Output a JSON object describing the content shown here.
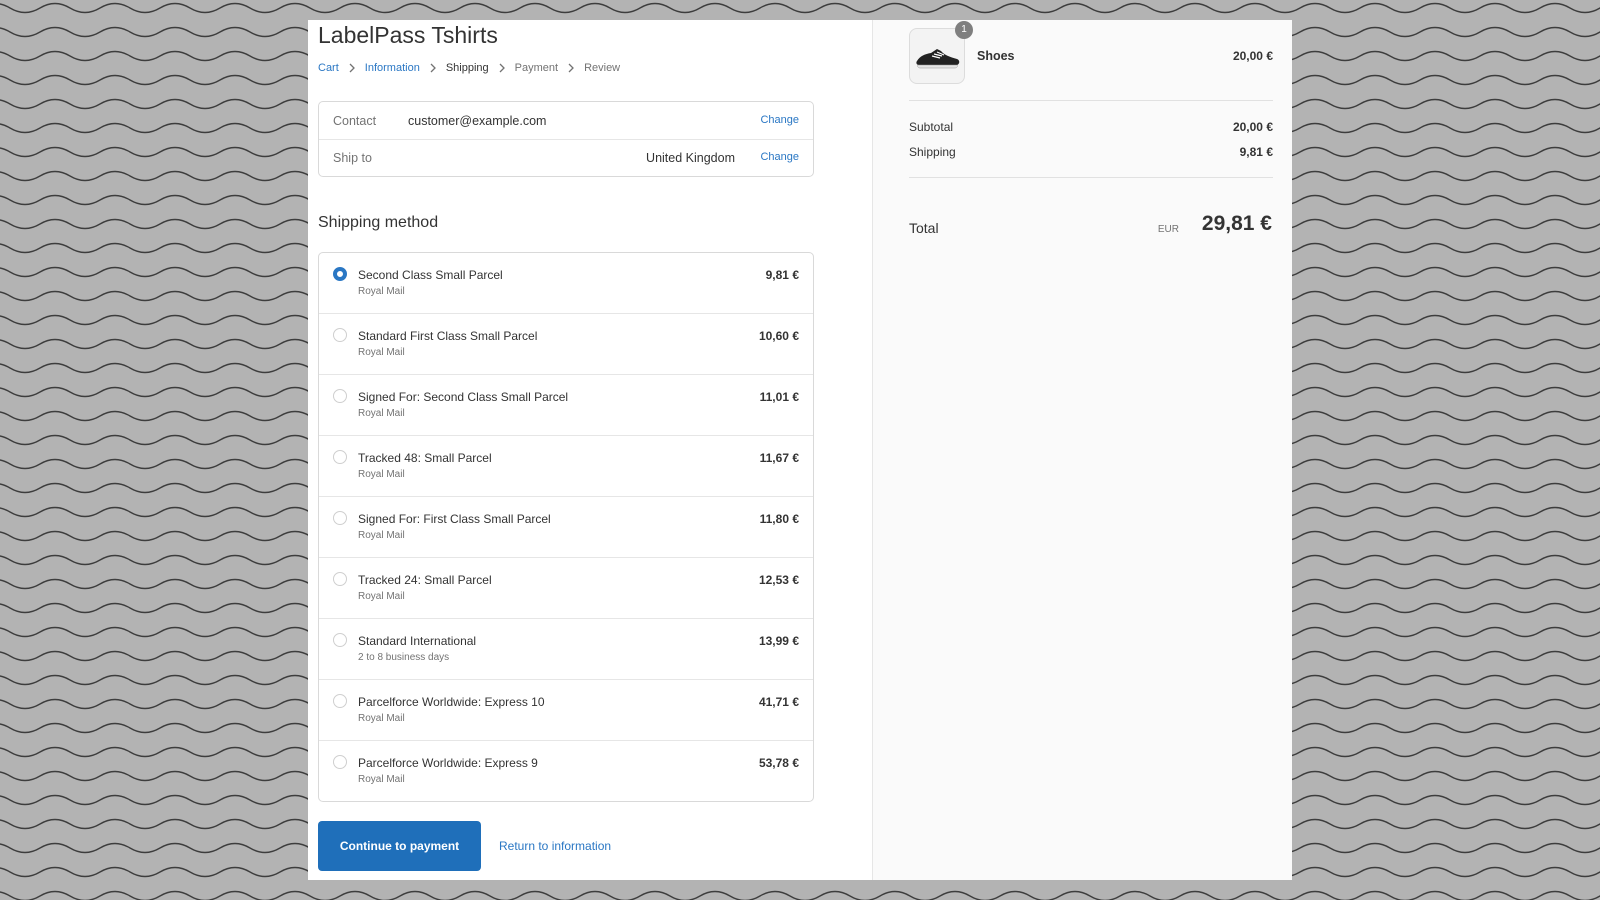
{
  "store": {
    "title": "LabelPass Tshirts"
  },
  "breadcrumb": [
    {
      "label": "Cart",
      "state": "link"
    },
    {
      "label": "Information",
      "state": "link"
    },
    {
      "label": "Shipping",
      "state": "current"
    },
    {
      "label": "Payment",
      "state": "upcoming"
    },
    {
      "label": "Review",
      "state": "upcoming"
    }
  ],
  "review": {
    "contact": {
      "label": "Contact",
      "value": "customer@example.com",
      "action": "Change"
    },
    "ship_to": {
      "label": "Ship to",
      "value": "United Kingdom",
      "action": "Change"
    }
  },
  "shipping": {
    "title": "Shipping method",
    "methods": [
      {
        "name": "Second Class Small Parcel",
        "sub": "Royal Mail",
        "price": "9,81 €",
        "selected": true
      },
      {
        "name": "Standard First Class Small Parcel",
        "sub": "Royal Mail",
        "price": "10,60 €",
        "selected": false
      },
      {
        "name": "Signed For: Second Class Small Parcel",
        "sub": "Royal Mail",
        "price": "11,01 €",
        "selected": false
      },
      {
        "name": "Tracked 48: Small Parcel",
        "sub": "Royal Mail",
        "price": "11,67 €",
        "selected": false
      },
      {
        "name": "Signed For: First Class Small Parcel",
        "sub": "Royal Mail",
        "price": "11,80 €",
        "selected": false
      },
      {
        "name": "Tracked 24: Small Parcel",
        "sub": "Royal Mail",
        "price": "12,53 €",
        "selected": false
      },
      {
        "name": "Standard International",
        "sub": "2 to 8 business days",
        "price": "13,99 €",
        "selected": false
      },
      {
        "name": "Parcelforce Worldwide: Express 10",
        "sub": "Royal Mail",
        "price": "41,71 €",
        "selected": false
      },
      {
        "name": "Parcelforce Worldwide: Express 9",
        "sub": "Royal Mail",
        "price": "53,78 €",
        "selected": false
      }
    ]
  },
  "actions": {
    "continue_label": "Continue to payment",
    "return_label": "Return to information"
  },
  "summary": {
    "product": {
      "name": "Shoes",
      "price": "20,00 €",
      "quantity": "1",
      "icon": "shoe-icon"
    },
    "subtotal_label": "Subtotal",
    "subtotal_value": "20,00 €",
    "shipping_label": "Shipping",
    "shipping_value": "9,81 €",
    "total_label": "Total",
    "currency": "EUR",
    "total_value": "29,81 €"
  },
  "colors": {
    "accent": "#2a77c4",
    "button": "#1f6fba",
    "background_pattern": "#b3b3b3"
  }
}
